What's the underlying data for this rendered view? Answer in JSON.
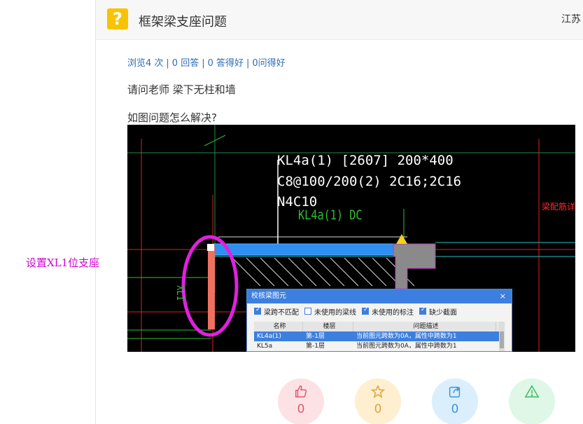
{
  "side_note": "设置XL1位支座",
  "header": {
    "badge": "?",
    "title": "框架梁支座问题",
    "region": "江苏"
  },
  "stats": {
    "views": "浏览4 次",
    "answers": "0 回答",
    "good_answers": "0 答得好",
    "good_questions": "0问得好"
  },
  "content": {
    "line1": "请问老师  梁下无柱和墙",
    "line2": "如图问题怎么解决?"
  },
  "cad": {
    "label_line1": "KL4a(1) [2607] 200*400",
    "label_line2": "C8@100/200(2) 2C16;2C16",
    "label_line3": "N4C10",
    "green_label": "KL4a(1) DC",
    "green_vertical": "XL1",
    "red_note": "梁配筋详见施工",
    "dialog": {
      "title": "校核梁图元",
      "close": "×",
      "options": [
        {
          "label": "梁跨不匹配",
          "checked": true
        },
        {
          "label": "未使用的梁线",
          "checked": false
        },
        {
          "label": "未使用的标注",
          "checked": true
        },
        {
          "label": "缺少截面",
          "checked": true
        }
      ],
      "columns": [
        "名称",
        "楼层",
        "问题描述"
      ],
      "rows": [
        {
          "name": "KL4a(1)",
          "floor": "第-1层",
          "desc": "当前图元跨数为0A，属性中跨数为1",
          "selected": true
        },
        {
          "name": "KL5a",
          "floor": "第-1层",
          "desc": "当前图元跨数为0A，属性中跨数为1",
          "selected": false
        }
      ]
    }
  },
  "actions": {
    "like": {
      "icon": "thumbs-up-icon",
      "count": "0"
    },
    "favorite": {
      "icon": "star-icon",
      "count": "0"
    },
    "share": {
      "icon": "share-icon",
      "count": "0"
    },
    "report": {
      "icon": "warning-icon",
      "count": "0"
    }
  }
}
